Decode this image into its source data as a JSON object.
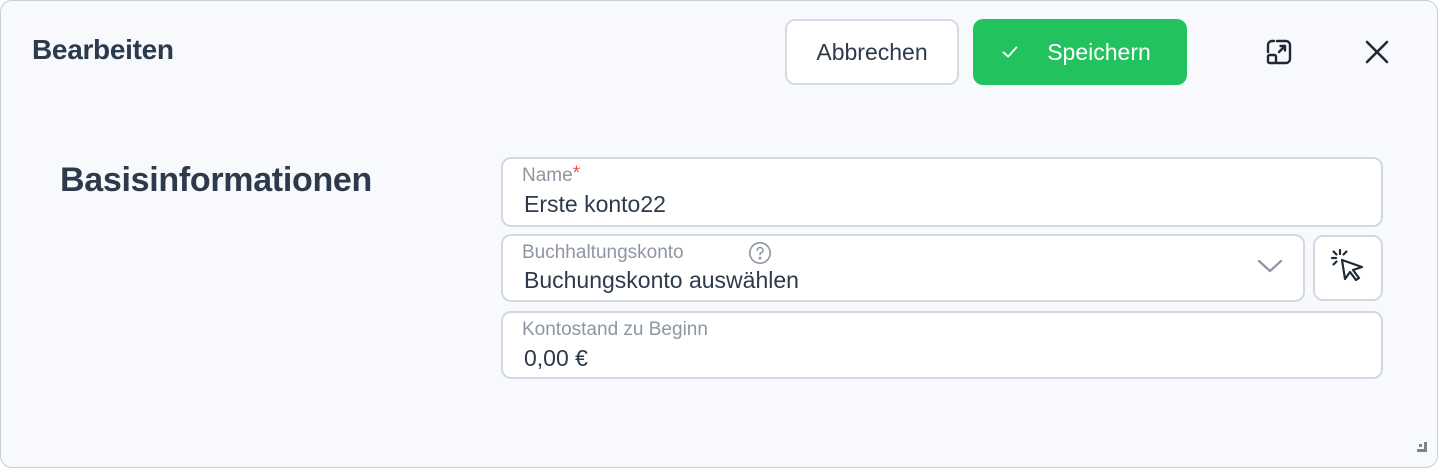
{
  "dialog": {
    "title": "Bearbeiten",
    "cancel_label": "Abbrechen",
    "save_label": "Speichern"
  },
  "section": {
    "title": "Basisinformationen"
  },
  "fields": {
    "name": {
      "label": "Name",
      "required_mark": "*",
      "value": "Erste konto22"
    },
    "account": {
      "label": "Buchhaltungskonto",
      "value": "Buchungskonto auswählen"
    },
    "balance": {
      "label": "Kontostand zu Beginn",
      "value": "0,00 €"
    }
  },
  "icons": {
    "save": "check-icon",
    "expand": "expand-icon",
    "close": "close-icon",
    "help": "question-circle-icon",
    "dropdown": "chevron-down-icon",
    "picker": "cursor-click-icon",
    "resize": "resize-handle-icon"
  },
  "colors": {
    "accent": "#22c35e",
    "text": "#2d3a4b",
    "required": "#ef5350",
    "background": "#f7f9fc"
  }
}
